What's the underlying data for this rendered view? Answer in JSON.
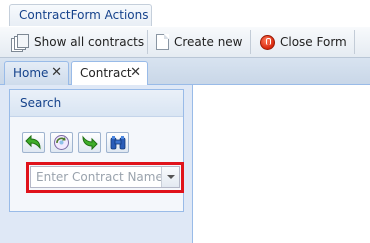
{
  "ribbon": {
    "tab_label": "ContractForm Actions",
    "buttons": {
      "show_all": "Show all contracts",
      "create_new": "Create new",
      "close_form": "Close Form"
    }
  },
  "document_tabs": {
    "home": "Home",
    "contract": "Contract",
    "close_glyph": "✕"
  },
  "search_panel": {
    "title": "Search",
    "actions": [
      "back-green-arrow-icon",
      "refresh-globe-icon",
      "forward-green-arrow-icon",
      "binoculars-icon"
    ],
    "contract_name_placeholder": "Enter Contract Name",
    "highlight_color": "#e0131b"
  }
}
